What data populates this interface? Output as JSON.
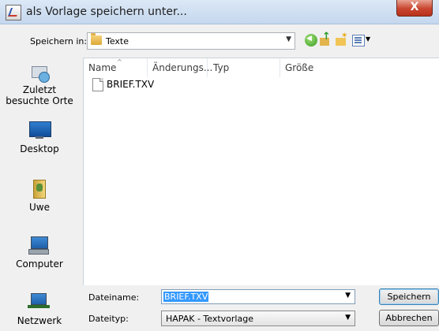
{
  "window": {
    "title": "als Vorlage speichern unter...",
    "close_glyph": "X"
  },
  "toolbar": {
    "lookin_label": "Speichern in:",
    "lookin_value": "Texte"
  },
  "places": [
    {
      "label_line1": "Zuletzt",
      "label_line2": "besuchte Orte",
      "icon": "recent-places-icon"
    },
    {
      "label": "Desktop",
      "icon": "desktop-icon"
    },
    {
      "label": "Uwe",
      "icon": "user-folder-icon"
    },
    {
      "label": "Computer",
      "icon": "computer-icon"
    },
    {
      "label": "Netzwerk",
      "icon": "network-icon"
    }
  ],
  "filelist": {
    "columns": [
      "Name",
      "Änderungs...",
      "Typ",
      "Größe"
    ],
    "files": [
      {
        "name": "BRIEF.TXV"
      }
    ]
  },
  "form": {
    "filename_label": "Dateiname:",
    "filename_value": "BRIEF.TXV",
    "filetype_label": "Dateityp:",
    "filetype_value": "HAPAK - Textvorlage"
  },
  "buttons": {
    "save": "Speichern",
    "cancel": "Abbrechen"
  }
}
